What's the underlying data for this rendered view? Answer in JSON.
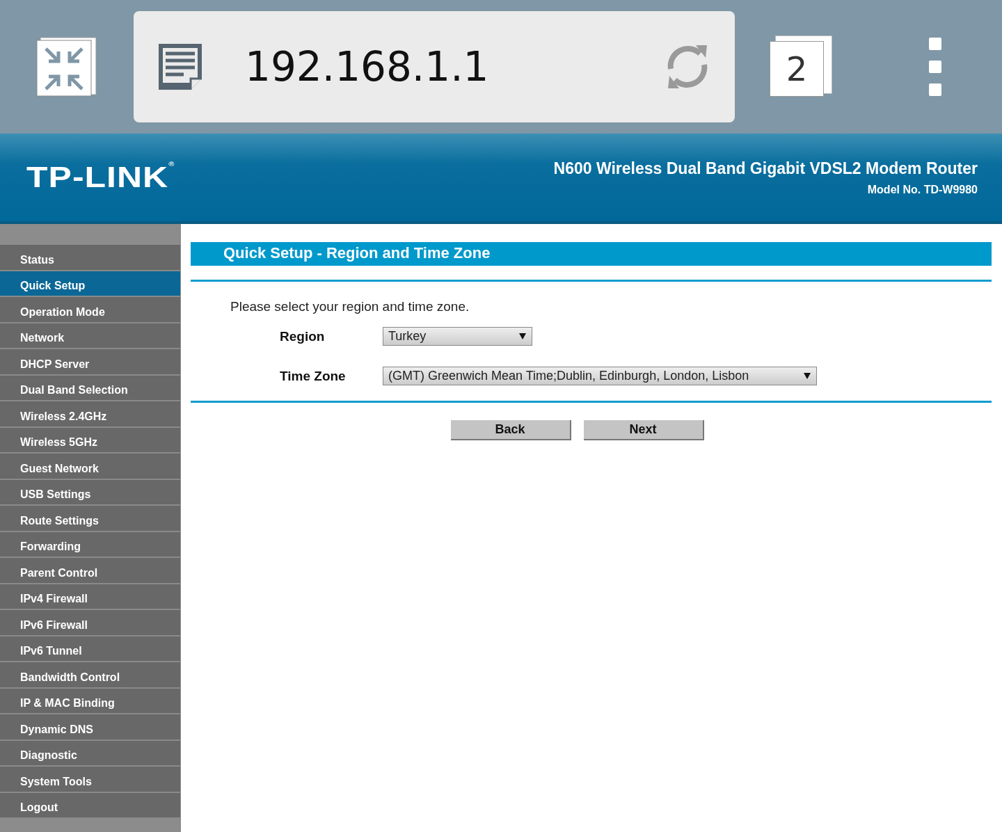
{
  "browser": {
    "url": "192.168.1.1",
    "tab_count": "2"
  },
  "header": {
    "logo": "TP-LINK$^{®}$",
    "product": "N600 Wireless Dual Band Gigabit VDSL2 Modem Router",
    "model": "Model No. TD-W9980"
  },
  "sidebar": {
    "items": [
      {
        "label": "Status",
        "selected": false
      },
      {
        "label": "Quick Setup",
        "selected": true
      },
      {
        "label": "Operation Mode",
        "selected": false
      },
      {
        "label": "Network",
        "selected": false
      },
      {
        "label": "DHCP Server",
        "selected": false
      },
      {
        "label": "Dual Band Selection",
        "selected": false
      },
      {
        "label": "Wireless 2.4GHz",
        "selected": false
      },
      {
        "label": "Wireless 5GHz",
        "selected": false
      },
      {
        "label": "Guest Network",
        "selected": false
      },
      {
        "label": "USB Settings",
        "selected": false
      },
      {
        "label": "Route Settings",
        "selected": false
      },
      {
        "label": "Forwarding",
        "selected": false
      },
      {
        "label": "Parent Control",
        "selected": false
      },
      {
        "label": "IPv4 Firewall",
        "selected": false
      },
      {
        "label": "IPv6 Firewall",
        "selected": false
      },
      {
        "label": "IPv6 Tunnel",
        "selected": false
      },
      {
        "label": "Bandwidth Control",
        "selected": false
      },
      {
        "label": "IP & MAC Binding",
        "selected": false
      },
      {
        "label": "Dynamic DNS",
        "selected": false
      },
      {
        "label": "Diagnostic",
        "selected": false
      },
      {
        "label": "System Tools",
        "selected": false
      },
      {
        "label": "Logout",
        "selected": false
      }
    ]
  },
  "content": {
    "title": "Quick Setup - Region and Time Zone",
    "intro": "Please select your region and time zone.",
    "fields": [
      {
        "label": "Region",
        "value": "Turkey",
        "wide": false
      },
      {
        "label": "Time Zone",
        "value": "(GMT) Greenwich Mean Time;Dublin, Edinburgh, London, Lisbon",
        "wide": true
      }
    ],
    "buttons": [
      "Back",
      "Next"
    ]
  }
}
